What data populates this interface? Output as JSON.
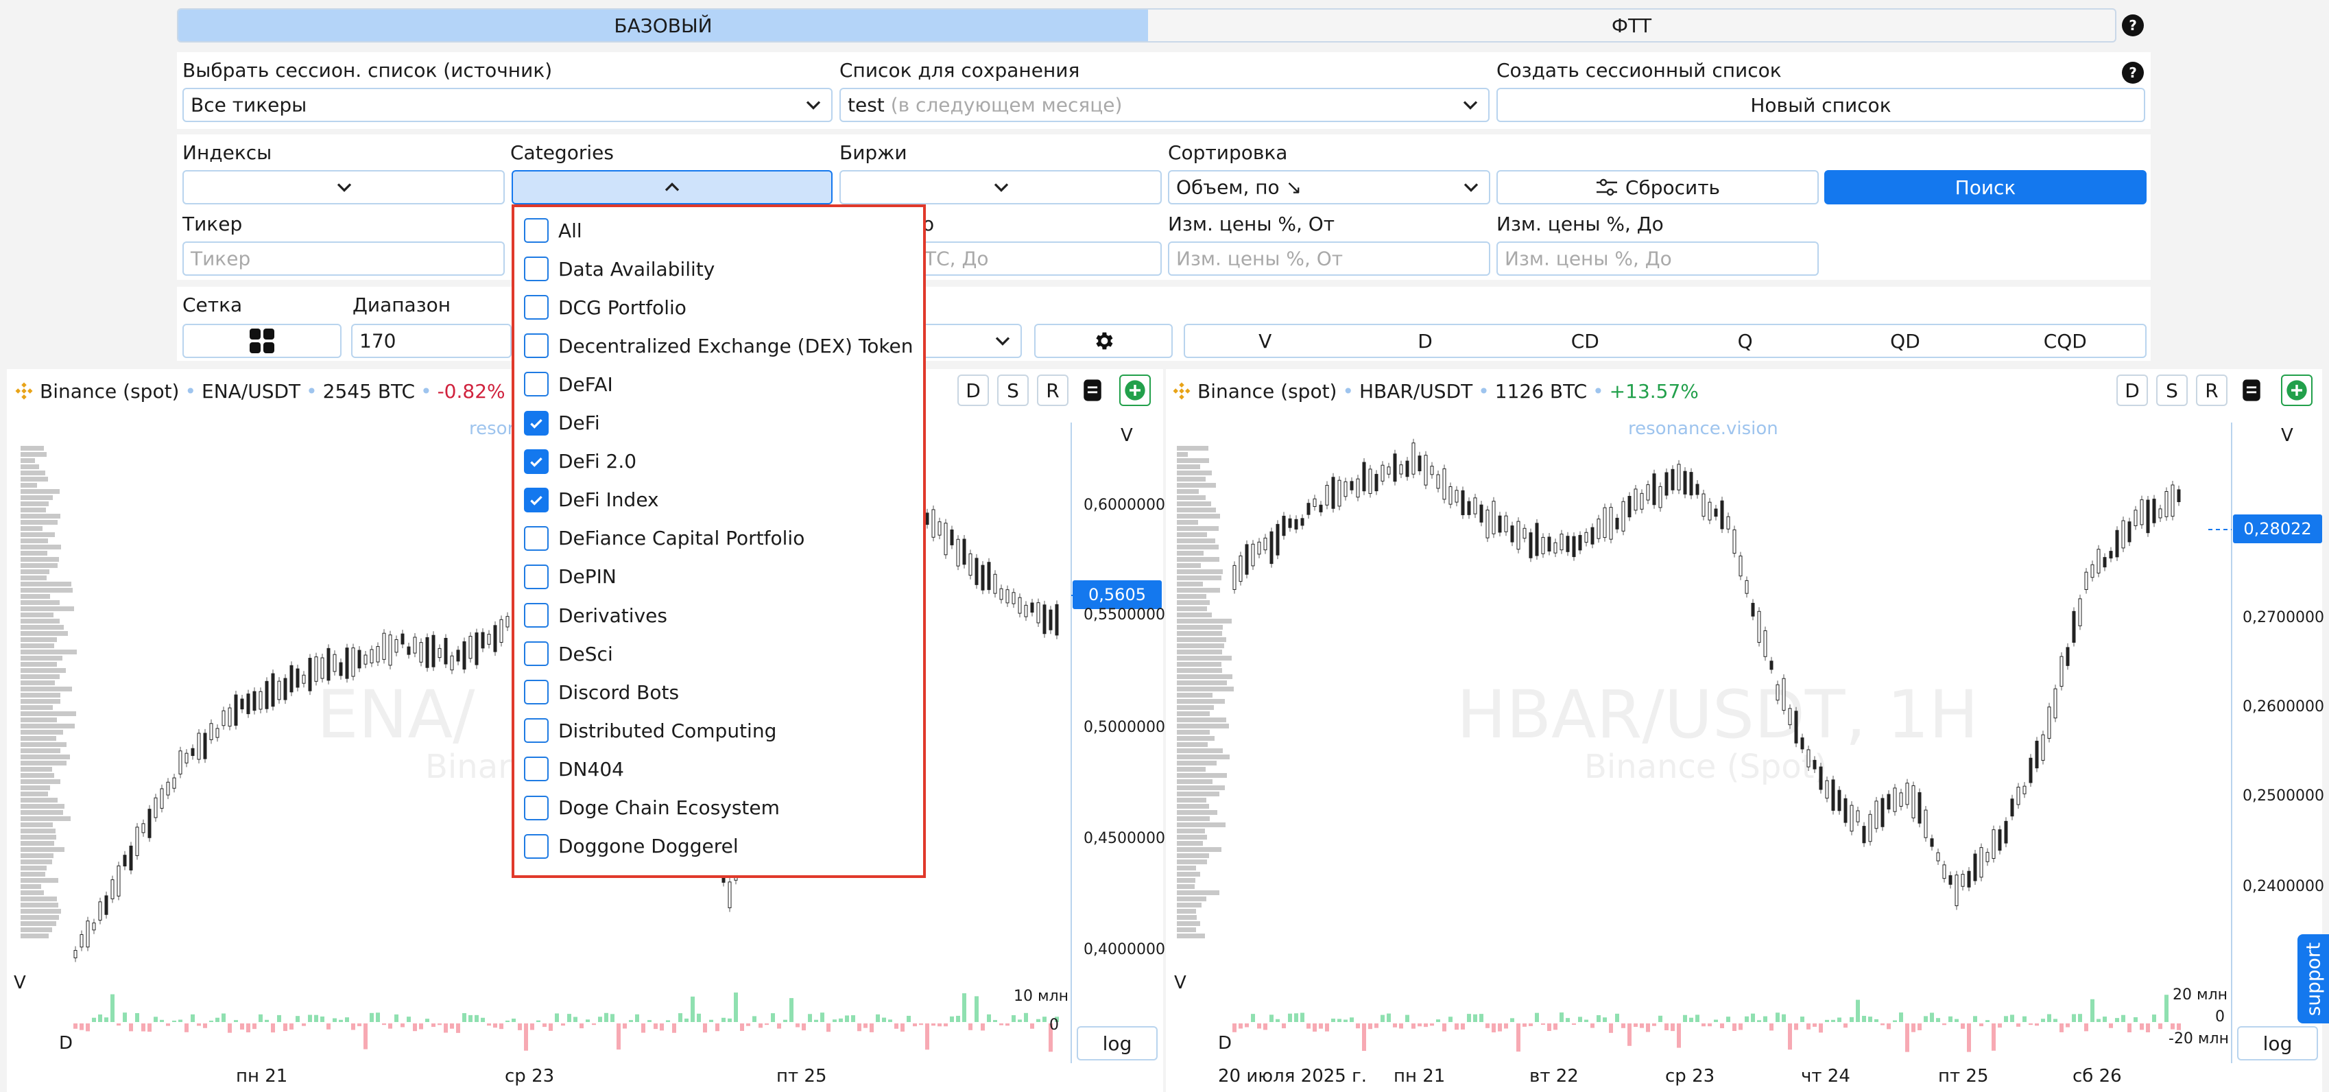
{
  "mode_tabs": {
    "basic": "БАЗОВЫЙ",
    "ftt": "ФТТ"
  },
  "session": {
    "source_label": "Выбрать сессион. список (источник)",
    "source_value": "Все тикеры",
    "save_label": "Список для сохранения",
    "save_value": "test",
    "save_hint": "(в следующем месяце)",
    "create_label": "Создать сессионный список",
    "create_button": "Новый список"
  },
  "filters": {
    "indexes_label": "Индексы",
    "categories_label": "Categories",
    "exchanges_label": "Биржи",
    "sort_label": "Сортировка",
    "sort_value": "Объем, по ↘",
    "reset_button": "Сбросить",
    "search_button": "Поиск",
    "ticker_label": "Тикер",
    "ticker_placeholder": "Тикер",
    "vol_to_label_partial": "о",
    "vol_to_placeholder_partial": "ТС, До",
    "price_from_label": "Изм. цены %, От",
    "price_from_placeholder": "Изм. цены %, От",
    "price_to_label": "Изм. цены %, До",
    "price_to_placeholder": "Изм. цены %, До"
  },
  "grid": {
    "grid_label": "Сетка",
    "range_label": "Диапазон",
    "range_value": "170",
    "timeframes": [
      "V",
      "D",
      "CD",
      "Q",
      "QD",
      "CQD"
    ]
  },
  "categories_dropdown": {
    "items": [
      {
        "label": "All",
        "checked": false
      },
      {
        "label": "Data Availability",
        "checked": false
      },
      {
        "label": "DCG Portfolio",
        "checked": false
      },
      {
        "label": "Decentralized Exchange (DEX) Token",
        "checked": false
      },
      {
        "label": "DeFAI",
        "checked": false
      },
      {
        "label": "DeFi",
        "checked": true
      },
      {
        "label": "DeFi 2.0",
        "checked": true
      },
      {
        "label": "DeFi Index",
        "checked": true
      },
      {
        "label": "DeFiance Capital Portfolio",
        "checked": false
      },
      {
        "label": "DePIN",
        "checked": false
      },
      {
        "label": "Derivatives",
        "checked": false
      },
      {
        "label": "DeSci",
        "checked": false
      },
      {
        "label": "Discord Bots",
        "checked": false
      },
      {
        "label": "Distributed Computing",
        "checked": false
      },
      {
        "label": "DN404",
        "checked": false
      },
      {
        "label": "Doge Chain Ecosystem",
        "checked": false
      },
      {
        "label": "Doggone Doggerel",
        "checked": false
      }
    ]
  },
  "charts": [
    {
      "exchange": "Binance (spot)",
      "pair": "ENA/USDT",
      "volume": "2545 BTC",
      "change": "-0.82%",
      "change_color": "#d0223d",
      "watermark": "resonance.vision",
      "watermark_partial": "resor",
      "big_watermark": "ENA/",
      "big_watermark_sub": "Binar",
      "buttons": [
        "D",
        "S",
        "R"
      ],
      "price_label": "0,5605",
      "y_ticks": [
        "0,6000000",
        "0,5500000",
        "0,5000000",
        "0,4500000",
        "0,4000000"
      ],
      "vol_ticks": [
        "10 млн",
        "0"
      ],
      "x_ticks": [
        "пн 21",
        "ср 23",
        "пт 25"
      ],
      "axis_v": "V",
      "profile_v": "V",
      "profile_d": "D",
      "log": "log"
    },
    {
      "exchange": "Binance (spot)",
      "pair": "HBAR/USDT",
      "volume": "1126 BTC",
      "change": "+13.57%",
      "change_color": "#22a04b",
      "watermark": "resonance.vision",
      "big_watermark": "HBAR/USDT, 1H",
      "big_watermark_sub": "Binance (Spot)",
      "buttons": [
        "D",
        "S",
        "R"
      ],
      "price_label": "0,28022",
      "y_ticks": [
        "0,2700000",
        "0,2600000",
        "0,2500000",
        "0,2400000"
      ],
      "vol_ticks": [
        "20 млн",
        "0",
        "-20 млн"
      ],
      "x_ticks": [
        "20 июля 2025 г.",
        "пн 21",
        "вт 22",
        "ср 23",
        "чт 24",
        "пт 25",
        "сб 26"
      ],
      "axis_v": "V",
      "profile_v": "V",
      "profile_d": "D",
      "log": "log"
    }
  ],
  "support": "support",
  "colors": {
    "accent": "#1478ee",
    "tab_active": "#b4d4f8",
    "highlight": "#e0392b"
  }
}
